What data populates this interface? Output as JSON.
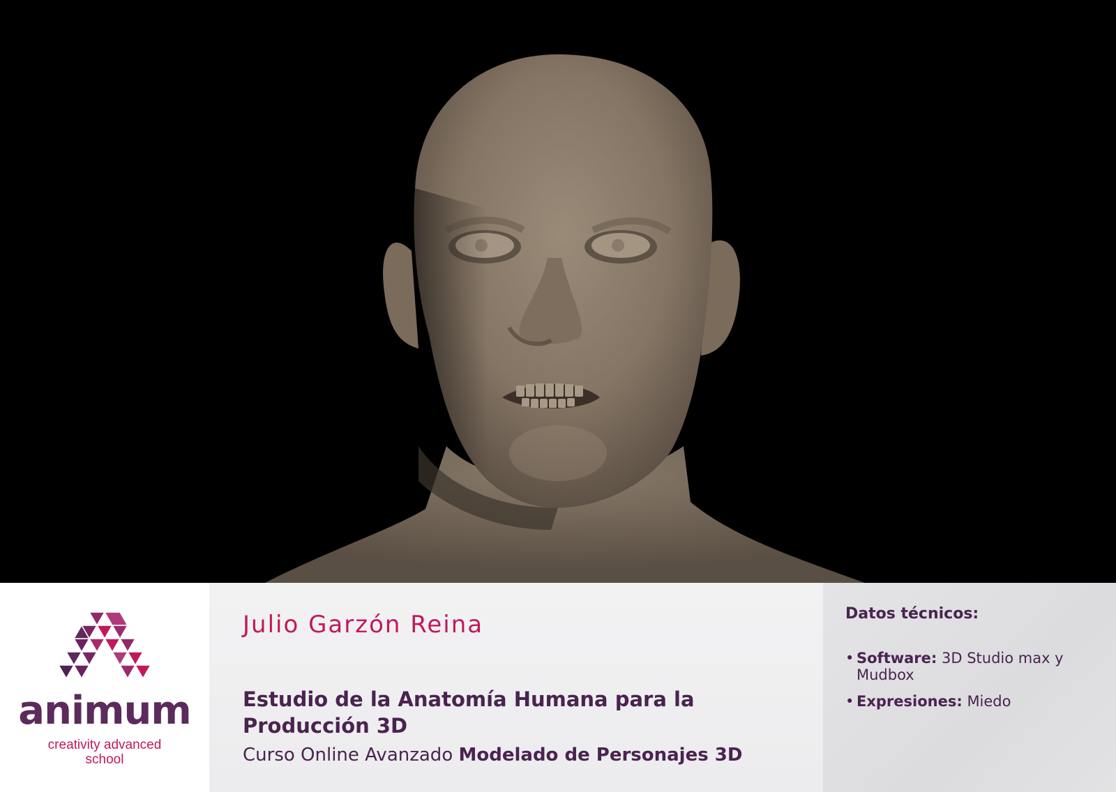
{
  "hero": {
    "subject": "3d-head-sculpt-fear-expression",
    "background_color": "#000000",
    "skin_color": "#8a7b6a"
  },
  "brand": {
    "name": "animum",
    "tagline_line1": "creativity advanced",
    "tagline_line2": "school",
    "colors": {
      "primary": "#5c2a5c",
      "accent": "#c2185b"
    }
  },
  "credits": {
    "author": "Julio Garzón Reina",
    "title_line1": "Estudio de la Anatomía Humana para la",
    "title_line2": "Producción 3D",
    "course_prefix": "Curso Online Avanzado",
    "course_name": "Modelado de Personajes 3D"
  },
  "tech": {
    "heading": "Datos técnicos:",
    "items": [
      {
        "label": "Software:",
        "value": "3D Studio max y Mudbox"
      },
      {
        "label": "Expresiones:",
        "value": "Miedo"
      }
    ]
  }
}
